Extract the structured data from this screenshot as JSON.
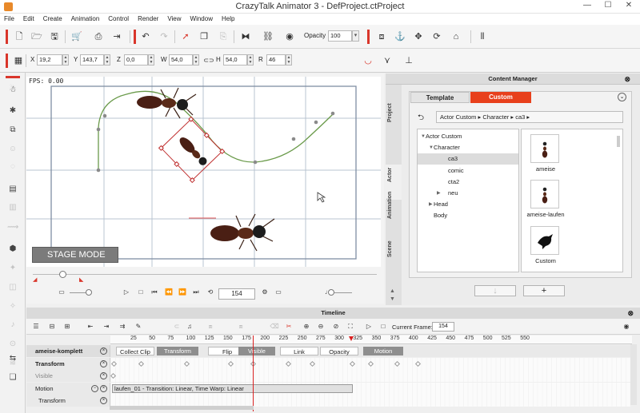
{
  "window": {
    "title": "CrazyTalk Animator 3  -  DefProject.ctProject",
    "min": "—",
    "max": "☐",
    "close": "✕"
  },
  "menu": [
    "File",
    "Edit",
    "Create",
    "Animation",
    "Control",
    "Render",
    "View",
    "Window",
    "Help"
  ],
  "toolbar1": {
    "opacity_label": "Opacity :",
    "opacity_value": "100"
  },
  "transform": {
    "x_label": "X",
    "x": "19,2",
    "y_label": "Y",
    "y": "143,7",
    "z_label": "Z",
    "z": "0,0",
    "w_label": "W",
    "w": "54,0",
    "h_label": "H",
    "h": "54,0",
    "r_label": "R",
    "r": "46"
  },
  "stage": {
    "fps": "FPS: 0.00",
    "mode_label": "STAGE MODE"
  },
  "playback": {
    "frame": "154"
  },
  "content_manager": {
    "title": "Content Manager",
    "tabs": [
      "Template",
      "Custom"
    ],
    "side_tabs": [
      "Project",
      "Actor",
      "Animation",
      "Scene"
    ],
    "breadcrumb": "Actor Custom ▸ Character ▸ ca3 ▸",
    "tree": [
      {
        "label": "Actor Custom",
        "level": 0,
        "arrow": "▼"
      },
      {
        "label": "Character",
        "level": 1,
        "arrow": "▼"
      },
      {
        "label": "ca3",
        "level": 2,
        "arrow": "",
        "selected": true
      },
      {
        "label": "comic",
        "level": 2,
        "arrow": ""
      },
      {
        "label": "cta2",
        "level": 2,
        "arrow": ""
      },
      {
        "label": "neu",
        "level": 2,
        "arrow": "▶"
      },
      {
        "label": "Head",
        "level": 1,
        "arrow": "▶"
      },
      {
        "label": "Body",
        "level": 1,
        "arrow": ""
      }
    ],
    "items": [
      {
        "label": "ameise",
        "icon": "ant-icon"
      },
      {
        "label": "ameise-laufen",
        "icon": "ant-icon"
      },
      {
        "label": "Custom",
        "icon": "bird-icon"
      }
    ],
    "down_btn": "↓",
    "add_btn": "+"
  },
  "timeline": {
    "title": "Timeline",
    "current_frame_label": "Current Frame:",
    "current_frame": "154",
    "ruler": [
      "25",
      "50",
      "75",
      "100",
      "125",
      "150",
      "175",
      "200",
      "225",
      "250",
      "275",
      "300",
      "325",
      "350",
      "375",
      "400",
      "425",
      "450",
      "475",
      "500",
      "525",
      "550"
    ],
    "tracks": [
      {
        "name": "ameise-komplett"
      },
      {
        "name": "Transform"
      },
      {
        "name": "Visible"
      },
      {
        "name": "Motion"
      },
      {
        "name": "Transform"
      }
    ],
    "clip_buttons": [
      "Collect Clip",
      "Transform",
      "Flip",
      "Visible",
      "Link",
      "Opacity",
      "Motion"
    ],
    "motion_clip": "laufen_01 - Transition: Linear, Time Warp: Linear"
  },
  "colors": {
    "accent": "#e8401c",
    "red": "#d9362b"
  }
}
